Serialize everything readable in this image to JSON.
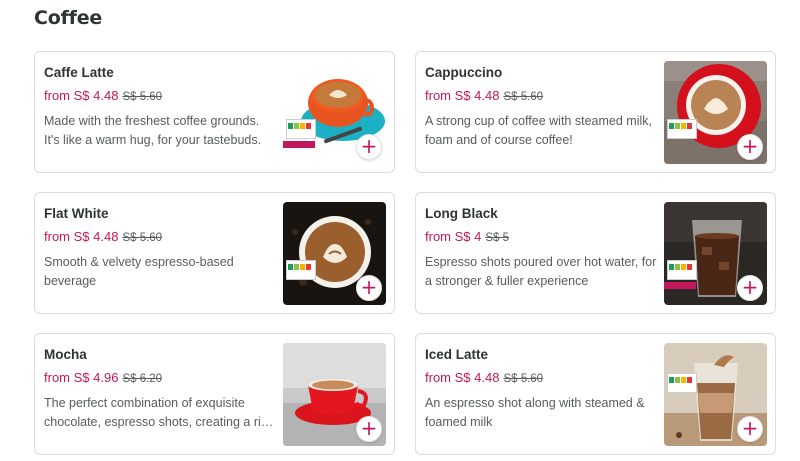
{
  "section": {
    "title": "Coffee"
  },
  "items": [
    {
      "name": "Caffe Latte",
      "price": "from S$ 4.48",
      "original_price": "S$ 5.60",
      "description": "Made with the freshest coffee grounds. It's like a warm hug, for your tastebuds.",
      "add_label": "+"
    },
    {
      "name": "Cappuccino",
      "price": "from S$ 4.48",
      "original_price": "S$ 5.60",
      "description": "A strong cup of coffee with steamed milk, foam and of course coffee!",
      "add_label": "+"
    },
    {
      "name": "Flat White",
      "price": "from S$ 4.48",
      "original_price": "S$ 5.60",
      "description": "Smooth & velvety espresso-based beverage",
      "add_label": "+"
    },
    {
      "name": "Long Black",
      "price": "from S$ 4",
      "original_price": "S$ 5",
      "description": "Espresso shots poured over hot water, for a stronger & fuller experience",
      "add_label": "+"
    },
    {
      "name": "Mocha",
      "price": "from S$ 4.96",
      "original_price": "S$ 6.20",
      "description": "The perfect combination of exquisite chocolate, espresso shots, creating a rich indulgence.",
      "add_label": "+"
    },
    {
      "name": "Iced Latte",
      "price": "from S$ 4.48",
      "original_price": "S$ 5.60",
      "description": "An espresso shot along with steamed & foamed milk",
      "add_label": "+"
    }
  ],
  "colors": {
    "accent": "#c2185b",
    "text": "#2e3333",
    "muted": "#585c5c",
    "border": "#dcdcdc"
  }
}
